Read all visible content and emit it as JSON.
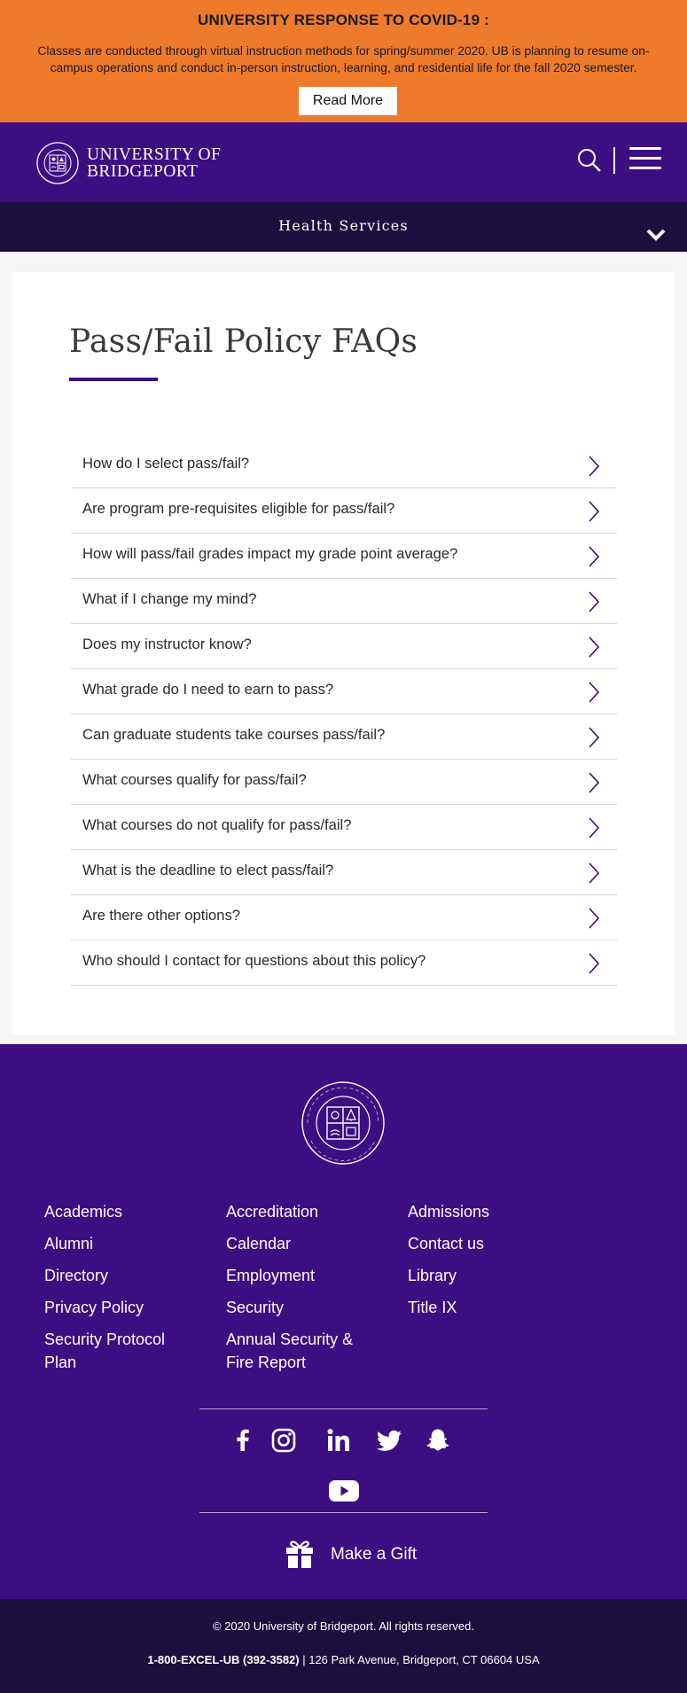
{
  "covid_banner": {
    "heading": "UNIVERSITY RESPONSE TO COVID-19 :",
    "message": "Classes are conducted through virtual instruction methods for spring/summer 2020. UB is planning to resume on-campus operations and conduct in-person instruction, learning, and residential life for the fall 2020 semester.",
    "read_more_label": "Read More",
    "background_color": "#ee7a2c"
  },
  "header": {
    "logo_line1": "UNIVERSITY OF",
    "logo_line2": "BRIDGEPORT",
    "search_icon": "search-icon",
    "menu_icon": "hamburger-menu-icon",
    "background_color": "#3d0d82"
  },
  "section_bar": {
    "title": "Health Services",
    "toggle_icon": "chevron-down-icon"
  },
  "main": {
    "page_title": "Pass/Fail Policy FAQs",
    "faqs": [
      {
        "question": "How do I select pass/fail?"
      },
      {
        "question": "Are program pre-requisites eligible for pass/fail?"
      },
      {
        "question": "How will pass/fail grades impact my grade point average?"
      },
      {
        "question": "What if I change my mind?"
      },
      {
        "question": "Does my instructor know?"
      },
      {
        "question": "What grade do I need to earn to pass?"
      },
      {
        "question": "Can graduate students take courses pass/fail?"
      },
      {
        "question": "What courses qualify for pass/fail?"
      },
      {
        "question": "What courses do not qualify for pass/fail?"
      },
      {
        "question": "What is the deadline to elect pass/fail?"
      },
      {
        "question": "Are there other options?"
      },
      {
        "question": "Who should I contact for questions about this policy?"
      }
    ]
  },
  "footer": {
    "links": [
      "Academics",
      "Accreditation",
      "Admissions",
      "Alumni",
      "Calendar",
      "Contact us",
      "Directory",
      "Employment",
      "Library",
      "Privacy Policy",
      "Security",
      "Title IX",
      "Security Protocol Plan",
      "Annual Security & Fire Report"
    ],
    "social_icons": [
      "facebook-icon",
      "instagram-icon",
      "linkedin-icon",
      "twitter-icon",
      "snapchat-icon",
      "youtube-icon"
    ],
    "gift_label": "Make a Gift",
    "copyright": "© 2020 University of Bridgeport. All rights reserved.",
    "phone": "1-800-EXCEL-UB (392-3582)",
    "address": " | 126 Park Avenue, Bridgeport, CT 06604 USA",
    "background_color": "#3d0d82",
    "bottom_color": "#1c0f3d"
  }
}
